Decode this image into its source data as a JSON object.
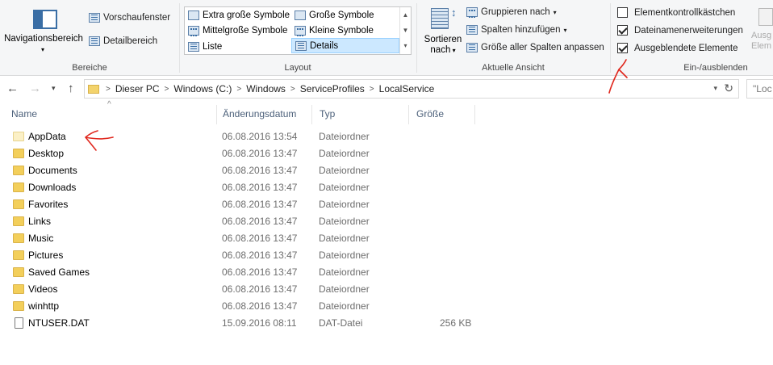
{
  "ribbon": {
    "bereiche": {
      "label": "Bereiche",
      "nav_pane": "Navigationsbereich",
      "preview_pane": "Vorschaufenster",
      "details_pane": "Detailbereich"
    },
    "layout": {
      "label": "Layout",
      "options": [
        {
          "label": "Extra große Symbole",
          "selected": false
        },
        {
          "label": "Große Symbole",
          "selected": false
        },
        {
          "label": "Mittelgroße Symbole",
          "selected": false
        },
        {
          "label": "Kleine Symbole",
          "selected": false
        },
        {
          "label": "Liste",
          "selected": false
        },
        {
          "label": "Details",
          "selected": true
        }
      ]
    },
    "aktuelle_ansicht": {
      "label": "Aktuelle Ansicht",
      "sort_line1": "Sortieren",
      "sort_line2": "nach",
      "group_by": "Gruppieren nach",
      "add_columns": "Spalten hinzufügen",
      "fit_columns": "Größe aller Spalten anpassen"
    },
    "ein_ausblenden": {
      "label": "Ein-/ausblenden",
      "checkboxes": [
        {
          "label": "Elementkontrollkästchen",
          "checked": false
        },
        {
          "label": "Dateinamenerweiterungen",
          "checked": true
        },
        {
          "label": "Ausgeblendete Elemente",
          "checked": true
        }
      ],
      "cut_off_line1": "Ausg",
      "cut_off_line2": "Elem"
    }
  },
  "address_bar": {
    "breadcrumbs": [
      "Dieser PC",
      "Windows (C:)",
      "Windows",
      "ServiceProfiles",
      "LocalService"
    ],
    "search_placeholder": "\"Loc"
  },
  "columns": {
    "name": "Name",
    "date": "Änderungsdatum",
    "type": "Typ",
    "size": "Größe"
  },
  "files": [
    {
      "name": "AppData",
      "date": "06.08.2016 13:54",
      "type": "Dateiordner",
      "size": "",
      "kind": "folder-hidden"
    },
    {
      "name": "Desktop",
      "date": "06.08.2016 13:47",
      "type": "Dateiordner",
      "size": "",
      "kind": "folder"
    },
    {
      "name": "Documents",
      "date": "06.08.2016 13:47",
      "type": "Dateiordner",
      "size": "",
      "kind": "folder"
    },
    {
      "name": "Downloads",
      "date": "06.08.2016 13:47",
      "type": "Dateiordner",
      "size": "",
      "kind": "folder"
    },
    {
      "name": "Favorites",
      "date": "06.08.2016 13:47",
      "type": "Dateiordner",
      "size": "",
      "kind": "folder"
    },
    {
      "name": "Links",
      "date": "06.08.2016 13:47",
      "type": "Dateiordner",
      "size": "",
      "kind": "folder"
    },
    {
      "name": "Music",
      "date": "06.08.2016 13:47",
      "type": "Dateiordner",
      "size": "",
      "kind": "folder"
    },
    {
      "name": "Pictures",
      "date": "06.08.2016 13:47",
      "type": "Dateiordner",
      "size": "",
      "kind": "folder"
    },
    {
      "name": "Saved Games",
      "date": "06.08.2016 13:47",
      "type": "Dateiordner",
      "size": "",
      "kind": "folder"
    },
    {
      "name": "Videos",
      "date": "06.08.2016 13:47",
      "type": "Dateiordner",
      "size": "",
      "kind": "folder"
    },
    {
      "name": "winhttp",
      "date": "06.08.2016 13:47",
      "type": "Dateiordner",
      "size": "",
      "kind": "folder"
    },
    {
      "name": "NTUSER.DAT",
      "date": "15.09.2016 08:11",
      "type": "DAT-Datei",
      "size": "256 KB",
      "kind": "file"
    }
  ],
  "colors": {
    "annotation": "#e0271d",
    "selection": "#cce8ff",
    "header_text": "#4c607a",
    "folder": "#f3cf5b"
  }
}
